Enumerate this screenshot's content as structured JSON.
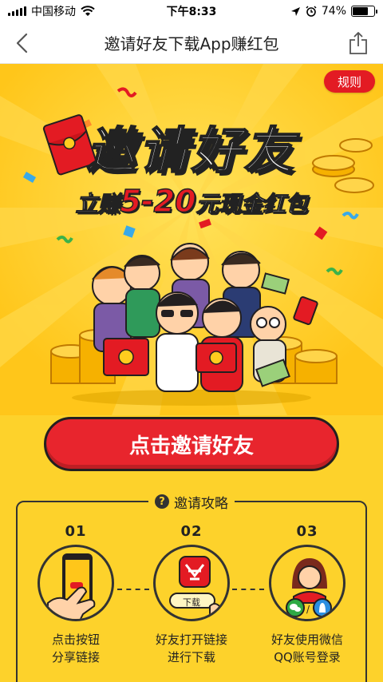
{
  "status": {
    "carrier": "中国移动",
    "time": "下午8:33",
    "battery": "74%",
    "battery_level": 0.74
  },
  "nav": {
    "title": "邀请好友下载App赚红包"
  },
  "hero": {
    "rules_label": "规则",
    "title": "邀请好友",
    "sub_prefix": "立赚",
    "sub_amount": "5-20",
    "sub_suffix": "元现金红包"
  },
  "invite_button": "点击邀请好友",
  "guide": {
    "title": "邀请攻略",
    "steps": [
      {
        "num": "01",
        "line1": "点击按钮",
        "line2": "分享链接"
      },
      {
        "num": "02",
        "line1": "好友打开链接",
        "line2": "进行下载",
        "badge": "下载"
      },
      {
        "num": "03",
        "line1": "好友使用微信",
        "line2": "QQ账号登录"
      }
    ]
  },
  "colors": {
    "background": "#fdd22b",
    "hero": "#ffcc1e",
    "accent_red": "#e31b23",
    "outline": "#231f20"
  }
}
